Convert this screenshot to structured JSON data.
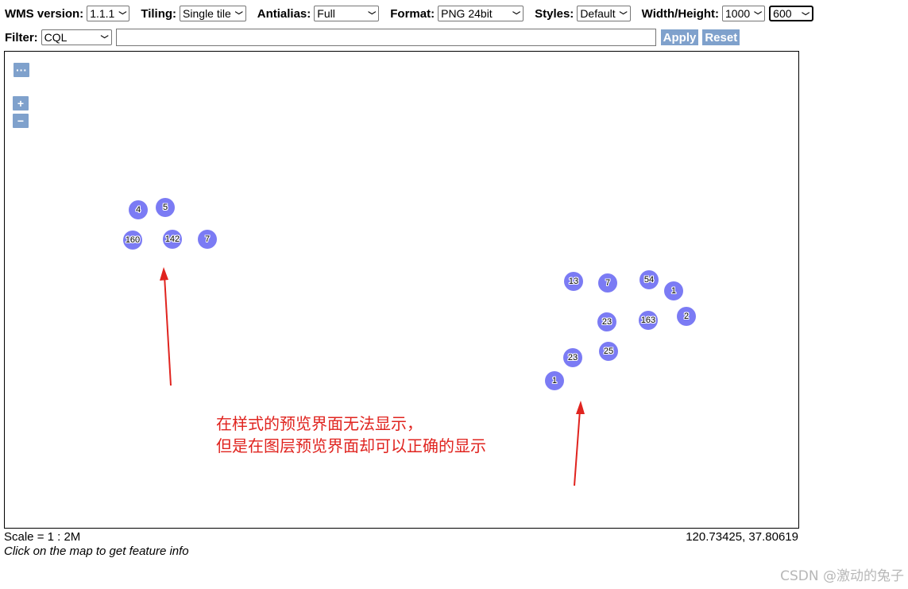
{
  "toolbar": {
    "wms_version": {
      "label": "WMS version:",
      "value": "1.1.1"
    },
    "tiling": {
      "label": "Tiling:",
      "value": "Single tile"
    },
    "antialias": {
      "label": "Antialias:",
      "value": "Full"
    },
    "format": {
      "label": "Format:",
      "value": "PNG 24bit"
    },
    "styles": {
      "label": "Styles:",
      "value": "Default"
    },
    "width_height": {
      "label": "Width/Height:",
      "width": "1000",
      "height": "600"
    },
    "filter": {
      "label": "Filter:",
      "type": "CQL",
      "value": ""
    },
    "apply_label": "Apply",
    "reset_label": "Reset"
  },
  "map": {
    "controls": {
      "layer_switcher": "···",
      "zoom_in": "+",
      "zoom_out": "−"
    },
    "clusters": [
      {
        "label": "4"
      },
      {
        "label": "5"
      },
      {
        "label": "160"
      },
      {
        "label": "142"
      },
      {
        "label": "7"
      },
      {
        "label": "13"
      },
      {
        "label": "7"
      },
      {
        "label": "54"
      },
      {
        "label": "1"
      },
      {
        "label": "23"
      },
      {
        "label": "163"
      },
      {
        "label": "2"
      },
      {
        "label": "25"
      },
      {
        "label": "23"
      },
      {
        "label": "1"
      }
    ],
    "annotation": [
      "在样式的预览界面无法显示，",
      "但是在图层预览界面却可以正确的显示"
    ],
    "colors": {
      "cluster_fill": "#7b7bf4",
      "annotation": "#e0241f",
      "control": "#7fa1cc"
    }
  },
  "footer": {
    "scale": "Scale = 1 : 2M",
    "coordinates": "120.73425, 37.80619",
    "hint": "Click on the map to get feature info"
  },
  "watermark": "CSDN @激动的兔子"
}
